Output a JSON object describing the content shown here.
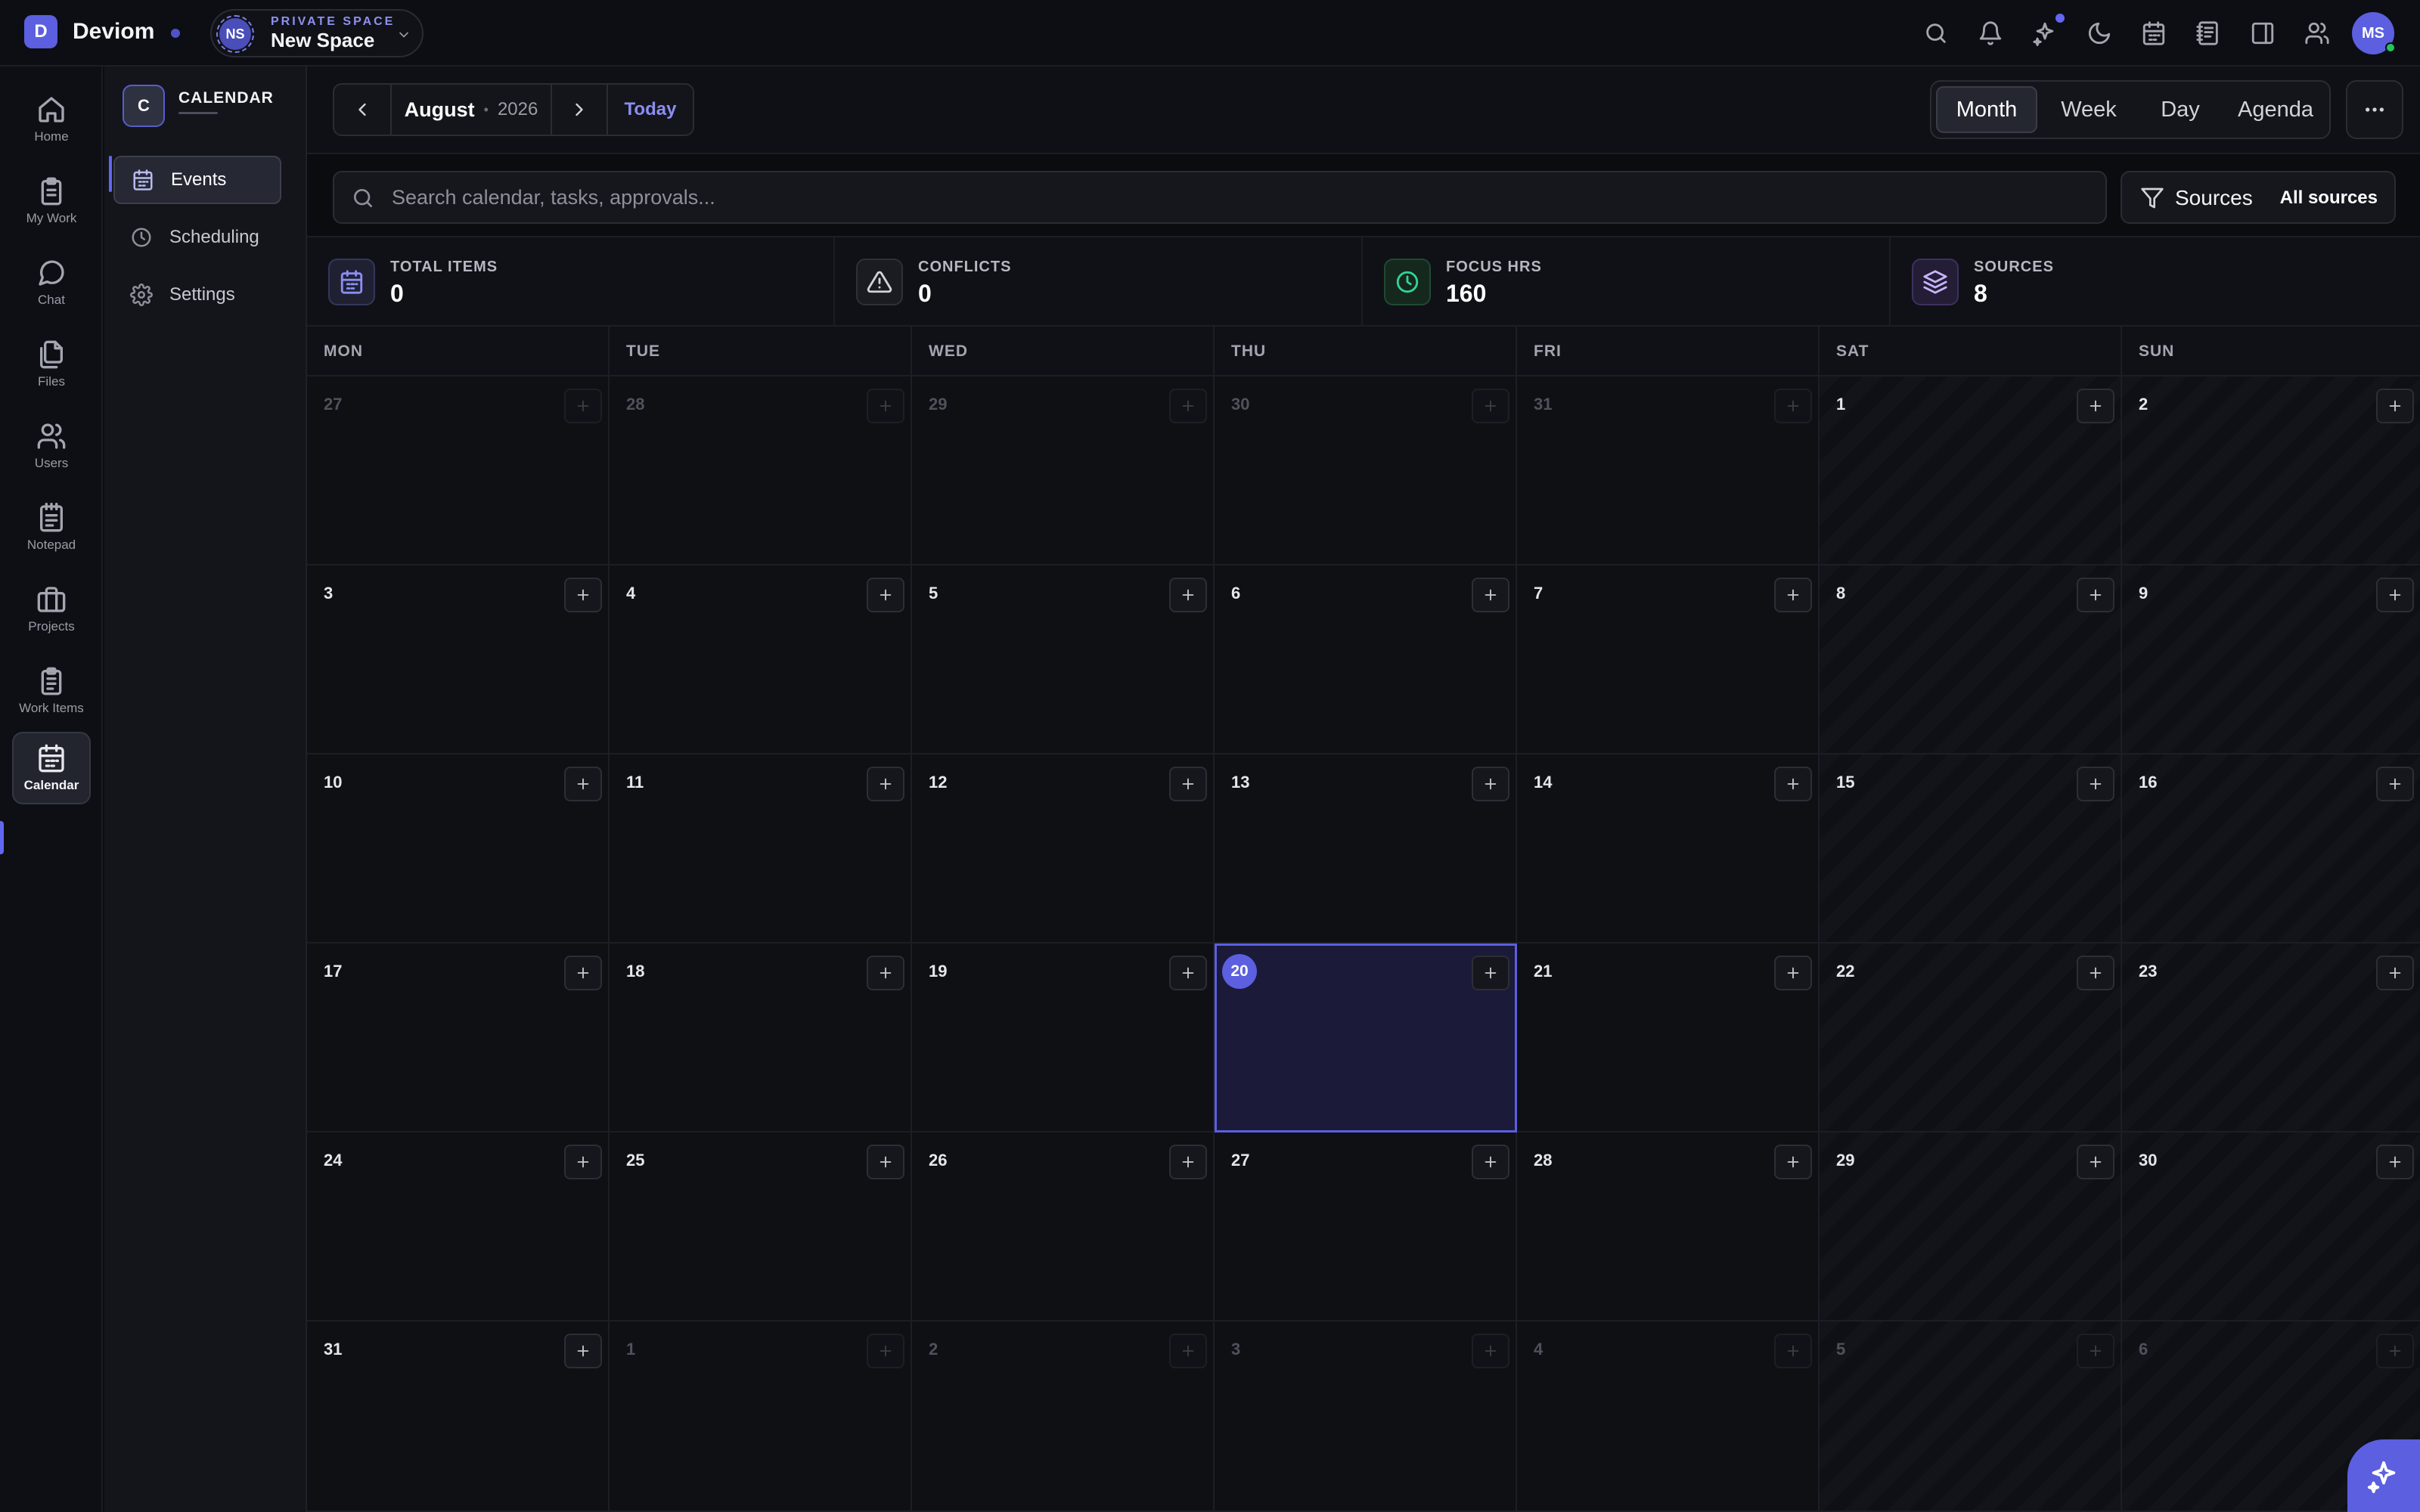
{
  "app": {
    "name": "Deviom",
    "logo_letter": "D"
  },
  "space": {
    "initials": "NS",
    "label": "PRIVATE SPACE",
    "name": "New Space"
  },
  "user": {
    "initials": "MS",
    "status_color": "#22c55e"
  },
  "topbar_icons": [
    "search-icon",
    "bell-icon",
    "sparkles-icon",
    "moon-icon",
    "calendar-icon",
    "notebook-icon",
    "panel-icon",
    "users-icon"
  ],
  "rail": {
    "items": [
      {
        "label": "Home",
        "icon": "home-icon"
      },
      {
        "label": "My Work",
        "icon": "clipboard-icon"
      },
      {
        "label": "Chat",
        "icon": "chat-icon"
      },
      {
        "label": "Files",
        "icon": "files-icon"
      },
      {
        "label": "Users",
        "icon": "users-icon"
      },
      {
        "label": "Notepad",
        "icon": "notepad-icon"
      },
      {
        "label": "Projects",
        "icon": "briefcase-icon"
      },
      {
        "label": "Work Items",
        "icon": "clipboard-list-icon"
      },
      {
        "label": "Calendar",
        "icon": "calendar-icon",
        "active": true
      }
    ]
  },
  "module": {
    "badge": "C",
    "title": "CALENDAR",
    "items": [
      {
        "label": "Events",
        "icon": "calendar-icon",
        "active": true
      },
      {
        "label": "Scheduling",
        "icon": "clock-icon"
      },
      {
        "label": "Settings",
        "icon": "gear-icon"
      }
    ]
  },
  "toolbar": {
    "month": "August",
    "separator": "•",
    "year": "2026",
    "today_label": "Today",
    "views": [
      "Month",
      "Week",
      "Day",
      "Agenda"
    ],
    "active_view": "Month"
  },
  "search": {
    "placeholder": "Search calendar, tasks, approvals...",
    "value": ""
  },
  "sources_filter": {
    "label": "Sources",
    "value": "All sources"
  },
  "stats": [
    {
      "label": "TOTAL ITEMS",
      "value": "0",
      "icon": "calendar-icon",
      "color": "#6366f1"
    },
    {
      "label": "CONFLICTS",
      "value": "0",
      "icon": "warning-icon",
      "color": "#9ca3af"
    },
    {
      "label": "FOCUS HRS",
      "value": "160",
      "icon": "clock-icon",
      "color": "#22c55e"
    },
    {
      "label": "SOURCES",
      "value": "8",
      "icon": "layers-icon",
      "color": "#a78bfa"
    }
  ],
  "calendar": {
    "weekdays": [
      "MON",
      "TUE",
      "WED",
      "THU",
      "FRI",
      "SAT",
      "SUN"
    ],
    "today": "20",
    "weeks": [
      [
        "27",
        "28",
        "29",
        "30",
        "31",
        "1",
        "2"
      ],
      [
        "3",
        "4",
        "5",
        "6",
        "7",
        "8",
        "9"
      ],
      [
        "10",
        "11",
        "12",
        "13",
        "14",
        "15",
        "16"
      ],
      [
        "17",
        "18",
        "19",
        "20",
        "21",
        "22",
        "23"
      ],
      [
        "24",
        "25",
        "26",
        "27",
        "28",
        "29",
        "30"
      ],
      [
        "31",
        "1",
        "2",
        "3",
        "4",
        "5",
        "6"
      ]
    ],
    "muted": [
      [
        true,
        true,
        true,
        true,
        true,
        false,
        false
      ],
      [
        false,
        false,
        false,
        false,
        false,
        false,
        false
      ],
      [
        false,
        false,
        false,
        false,
        false,
        false,
        false
      ],
      [
        false,
        false,
        false,
        false,
        false,
        false,
        false
      ],
      [
        false,
        false,
        false,
        false,
        false,
        false,
        false
      ],
      [
        false,
        true,
        true,
        true,
        true,
        true,
        true
      ]
    ]
  },
  "colors": {
    "accent": "#5b5fe0",
    "background": "#0b0c10"
  }
}
